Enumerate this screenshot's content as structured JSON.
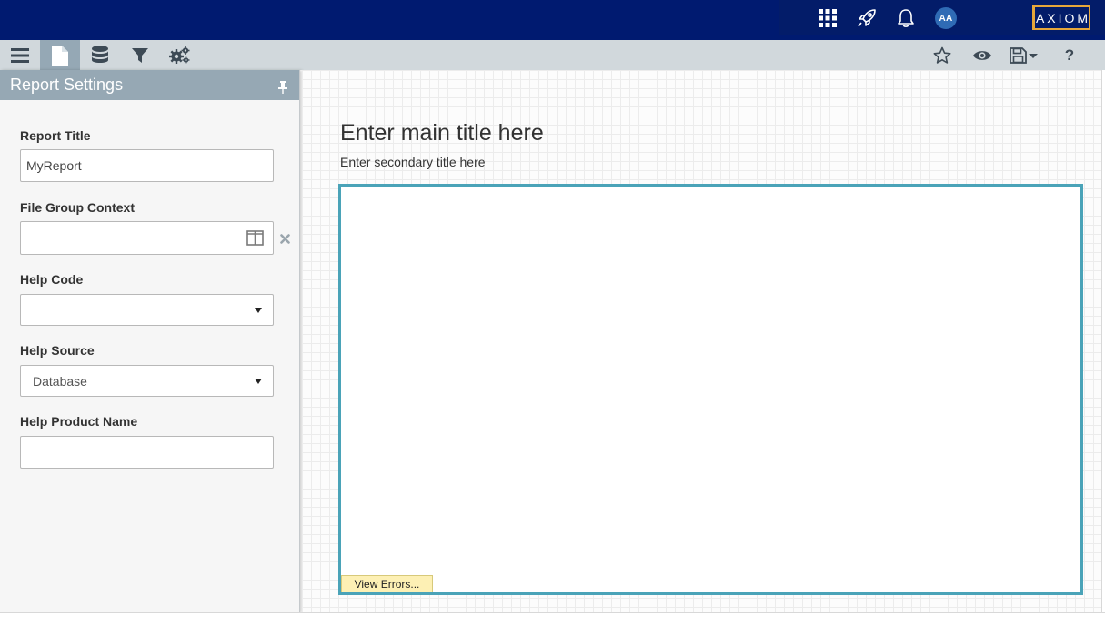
{
  "header": {
    "icons": [
      "apps-grid-icon",
      "rocket-icon",
      "bell-icon"
    ],
    "avatar_initials": "AA",
    "brand": "AXIOM",
    "colors": {
      "bar": "#001a70",
      "brand_accent": "#e7a73a"
    }
  },
  "toolbar": {
    "left_icons": [
      "menu-icon",
      "document-icon",
      "database-icon",
      "filter-icon",
      "settings-gears-icon"
    ],
    "active": "document-icon",
    "right_icons": [
      "star-icon",
      "eye-icon",
      "save-icon",
      "help-icon"
    ],
    "help_label": "?"
  },
  "panel": {
    "title": "Report Settings",
    "fields": {
      "report_title": {
        "label": "Report Title",
        "value": "MyReport"
      },
      "file_group_context": {
        "label": "File Group Context",
        "value": ""
      },
      "help_code": {
        "label": "Help Code",
        "value": ""
      },
      "help_source": {
        "label": "Help Source",
        "value": "Database"
      },
      "help_product_name": {
        "label": "Help Product Name",
        "value": ""
      }
    }
  },
  "canvas": {
    "main_title": "Enter main title here",
    "secondary_title": "Enter secondary title here",
    "view_errors": "View Errors..."
  }
}
